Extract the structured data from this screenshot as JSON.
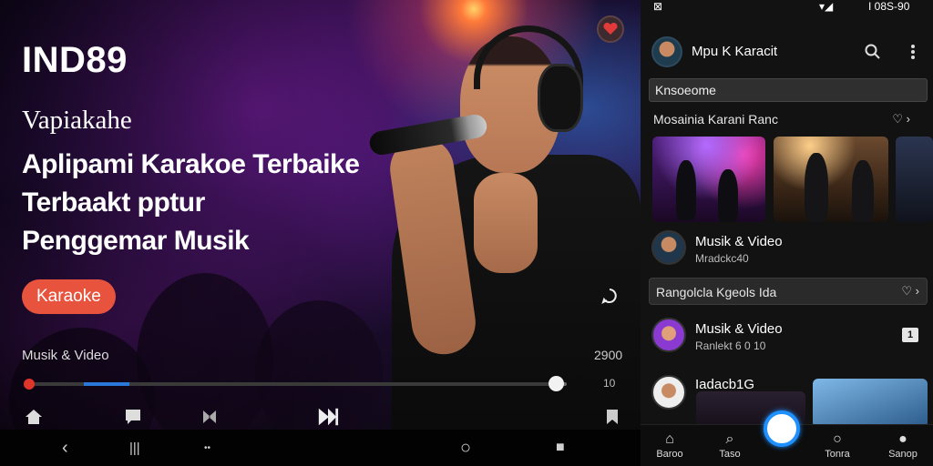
{
  "hero": {
    "brand": "IND89",
    "tagline": "Vapiakahe",
    "headline_lines": [
      "Aplipami Karakoe Terbaike",
      "Terbaakt pptur",
      "Penggemar Musik"
    ],
    "cta_label": "Karaoke",
    "media_label": "Musik & Video",
    "media_time": "2900",
    "progress_end": "10",
    "progress_fraction": 0.98
  },
  "sysnav": {
    "back": "‹",
    "recents": "|||",
    "dots": "••",
    "home": "○",
    "stop": "■"
  },
  "app": {
    "status": {
      "left_icon": "⊠",
      "signal": "▾◢",
      "right_text": "I 08S-90"
    },
    "header_title": "Mpu K Karacit",
    "search": {
      "value": "Knsoeome",
      "placeholder": ""
    },
    "section1": {
      "title": "Mosainia Karani Ranc",
      "icons": "♡ ›"
    },
    "row1": {
      "title": "Musik & Video",
      "sub": "Mradckc40"
    },
    "section2": {
      "title": "Rangolcla Kgeols Ida",
      "icons": "♡ ›"
    },
    "row2": {
      "title": "Musik & Video",
      "sub": "Ranlekt 6 0 10",
      "icon": "1"
    },
    "row3": {
      "title": "Iadacb1G"
    },
    "bottom_nav": [
      {
        "label": "Baroo",
        "icon": "home-icon"
      },
      {
        "label": "Taso",
        "icon": "search-icon"
      },
      {
        "label": "Tonra",
        "icon": "circle-icon"
      },
      {
        "label": "Sanop",
        "icon": "profile-icon"
      }
    ]
  },
  "colors": {
    "accent": "#e8533e",
    "nav_center": "#1e90ff",
    "progress_start": "#e0352b"
  }
}
